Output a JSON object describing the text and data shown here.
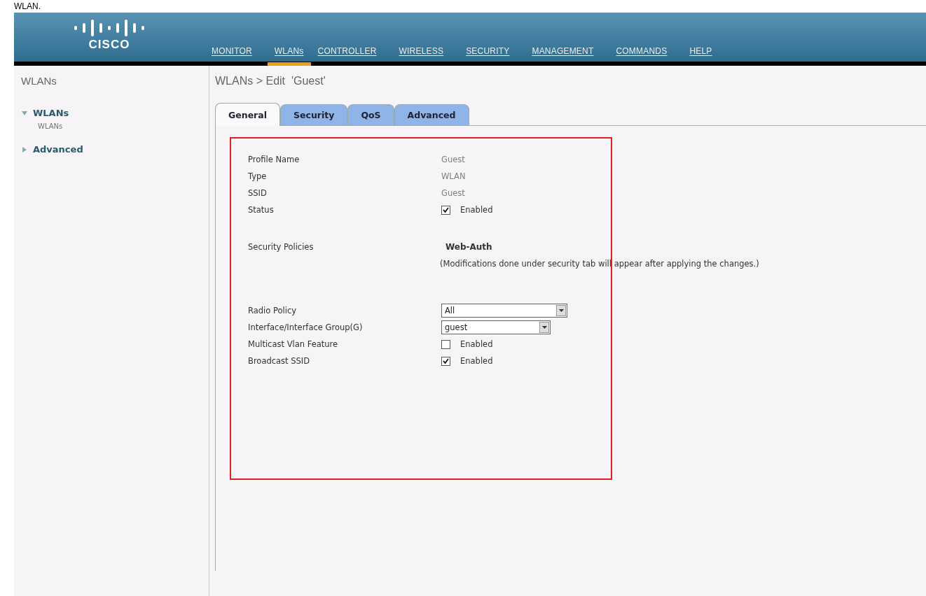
{
  "caption": "WLAN.",
  "header": {
    "logo": "CISCO",
    "menu": [
      {
        "label": "MONITOR",
        "selected": false
      },
      {
        "label": "WLANs",
        "selected": true
      },
      {
        "label": "CONTROLLER",
        "selected": false
      },
      {
        "label": "WIRELESS",
        "selected": false
      },
      {
        "label": "SECURITY",
        "selected": false
      },
      {
        "label": "MANAGEMENT",
        "selected": false
      },
      {
        "label": "COMMANDS",
        "selected": false
      },
      {
        "label": "HELP",
        "selected": false
      }
    ]
  },
  "sidebar": {
    "title": "WLANs",
    "items": [
      {
        "label": "WLANs",
        "expanded": true,
        "children": [
          {
            "label": "WLANs"
          }
        ]
      },
      {
        "label": "Advanced",
        "expanded": false
      }
    ]
  },
  "page_title": "WLANs > Edit  'Guest'",
  "tabs": [
    {
      "label": "General",
      "selected": true
    },
    {
      "label": "Security",
      "selected": false
    },
    {
      "label": "QoS",
      "selected": false
    },
    {
      "label": "Advanced",
      "selected": false
    }
  ],
  "fields": [
    {
      "kind": "text",
      "label": "Profile Name",
      "value": "Guest"
    },
    {
      "kind": "text",
      "label": "Type",
      "value": "WLAN"
    },
    {
      "kind": "text",
      "label": "SSID",
      "value": "Guest"
    },
    {
      "kind": "checkbox",
      "label": "Status",
      "checked": true,
      "option": "Enabled"
    },
    {
      "kind": "policy",
      "label": "Security Policies",
      "value": "Web-Auth",
      "note": "(Modifications done under security tab will appear after applying the changes.)"
    },
    {
      "kind": "select",
      "label": "Radio Policy",
      "value": "All"
    },
    {
      "kind": "select",
      "label": "Interface/Interface Group(G)",
      "value": "guest"
    },
    {
      "kind": "checkbox",
      "label": "Multicast Vlan Feature",
      "checked": false,
      "option": "Enabled"
    },
    {
      "kind": "checkbox",
      "label": "Broadcast SSID",
      "checked": true,
      "option": "Enabled"
    }
  ]
}
